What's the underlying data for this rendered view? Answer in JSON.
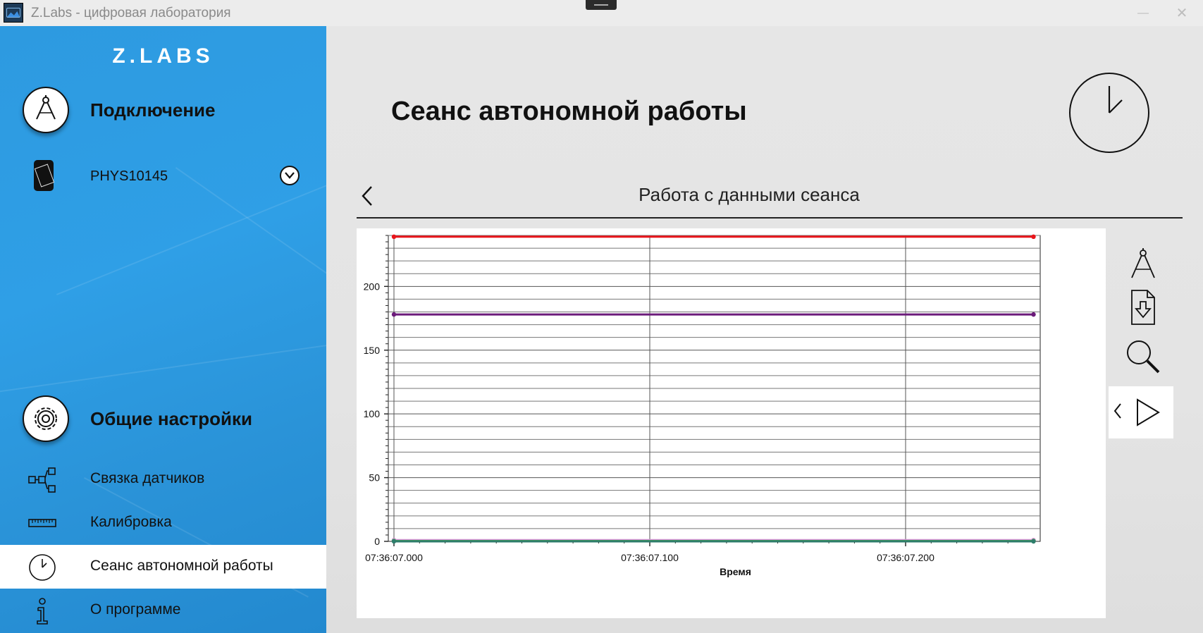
{
  "window": {
    "title": "Z.Labs - цифровая лаборатория",
    "minimize": "—",
    "close": "✕"
  },
  "sidebar": {
    "logo": "Z.LABS",
    "connection_label": "Подключение",
    "device_name": "PHYS10145",
    "settings_label": "Общие настройки",
    "items": [
      {
        "label": "Связка датчиков",
        "icon": "sensor-link-icon",
        "active": false
      },
      {
        "label": "Калибровка",
        "icon": "ruler-icon",
        "active": false
      },
      {
        "label": "Сеанс автономной работы",
        "icon": "clock-icon",
        "active": true
      },
      {
        "label": "О программе",
        "icon": "info-icon",
        "active": false
      }
    ]
  },
  "main": {
    "title": "Сеанс автономной работы",
    "subtitle": "Работа с данными сеанса"
  },
  "tools": [
    "measure-icon",
    "export-icon",
    "zoom-icon",
    "prev-icon",
    "play-icon"
  ],
  "chart_data": {
    "type": "line",
    "xlabel": "Время",
    "ylabel": "",
    "x_ticks": [
      "07:36:07.000",
      "07:36:07.100",
      "07:36:07.200"
    ],
    "x_domain_ms": [
      0,
      250
    ],
    "y_ticks": [
      0,
      50,
      100,
      150,
      200
    ],
    "ylim": [
      0,
      240
    ],
    "grid": true,
    "series": [
      {
        "color": "#e8151b",
        "x_ms": [
          0,
          250
        ],
        "values": [
          239,
          239
        ]
      },
      {
        "color": "#6b1a7a",
        "x_ms": [
          0,
          250
        ],
        "values": [
          178,
          178
        ]
      },
      {
        "color": "#d68fd6",
        "x_ms": [
          0,
          250
        ],
        "values": [
          1,
          1
        ]
      },
      {
        "color": "#4caf50",
        "x_ms": [
          0,
          250
        ],
        "values": [
          0.3,
          0.3
        ]
      },
      {
        "color": "#2e7d6b",
        "x_ms": [
          0,
          250
        ],
        "values": [
          0,
          0
        ]
      }
    ]
  }
}
